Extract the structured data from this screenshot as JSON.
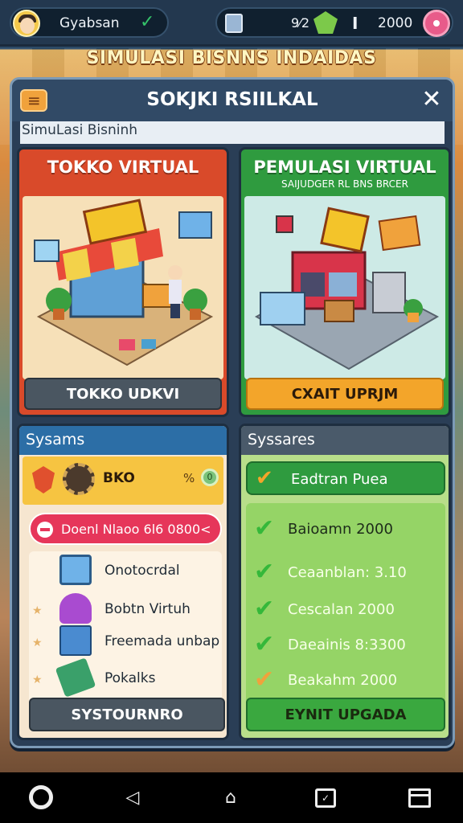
{
  "topbar": {
    "username": "Gyabsan",
    "check_glyph": "✓",
    "res_percent": "9⁄2",
    "res_mark": "I",
    "res_amount": "2000",
    "icons": [
      "avatar",
      "phone-icon",
      "gem-icon",
      "donut-icon"
    ]
  },
  "banner": "SIMULASI BISNNS INDAIDAS",
  "panel": {
    "title": "SOKJKI RSIILKAL",
    "subtitle": "SimuLasi Bisninh",
    "close_glyph": "✕",
    "menu_glyph": "≡"
  },
  "cards": [
    {
      "title": "TOKKO VIRTUAL",
      "subtitle": "",
      "button": "TOKKO UDKVI",
      "accent": "#d94a2a"
    },
    {
      "title": "PEMULASI VIRTUAL",
      "subtitle": "SAIJUDGER RL BNS BRCER",
      "button": "CXAIT UPRJM",
      "accent": "#2f9b3f"
    }
  ],
  "left_panel": {
    "header": "Sysams",
    "stat_text": "BKO",
    "stat_percent": "%",
    "stat_coin": "0",
    "alert": "Doenl Nlaoo 6l6 0800<",
    "tasks": [
      {
        "label": "Onotocrdal",
        "icon": "monitor-icon"
      },
      {
        "label": "Bobtn Virtuh",
        "icon": "person-icon"
      },
      {
        "label": "Freemada unbap",
        "icon": "book-icon"
      },
      {
        "label": "Pokalks",
        "icon": "tools-icon"
      }
    ],
    "button": "SYSTOURNRO"
  },
  "right_panel": {
    "header": "Syssares",
    "highlight": "Eadtran Puea",
    "items": [
      {
        "label": "Baioamn 2000",
        "style": "dark",
        "check": "green"
      },
      {
        "label": "Ceaanblan: 3.10",
        "style": "light",
        "check": "green"
      },
      {
        "label": "Cescalan 2000",
        "style": "light",
        "check": "green"
      },
      {
        "label": "Daeainis 8:3300",
        "style": "light",
        "check": "green"
      },
      {
        "label": "Beakahm 2000",
        "style": "light",
        "check": "orange"
      }
    ],
    "button": "EYNIT UPGADA"
  },
  "navbar": [
    "settings-icon",
    "back-icon",
    "home-icon",
    "recent-icon",
    "apps-icon"
  ]
}
